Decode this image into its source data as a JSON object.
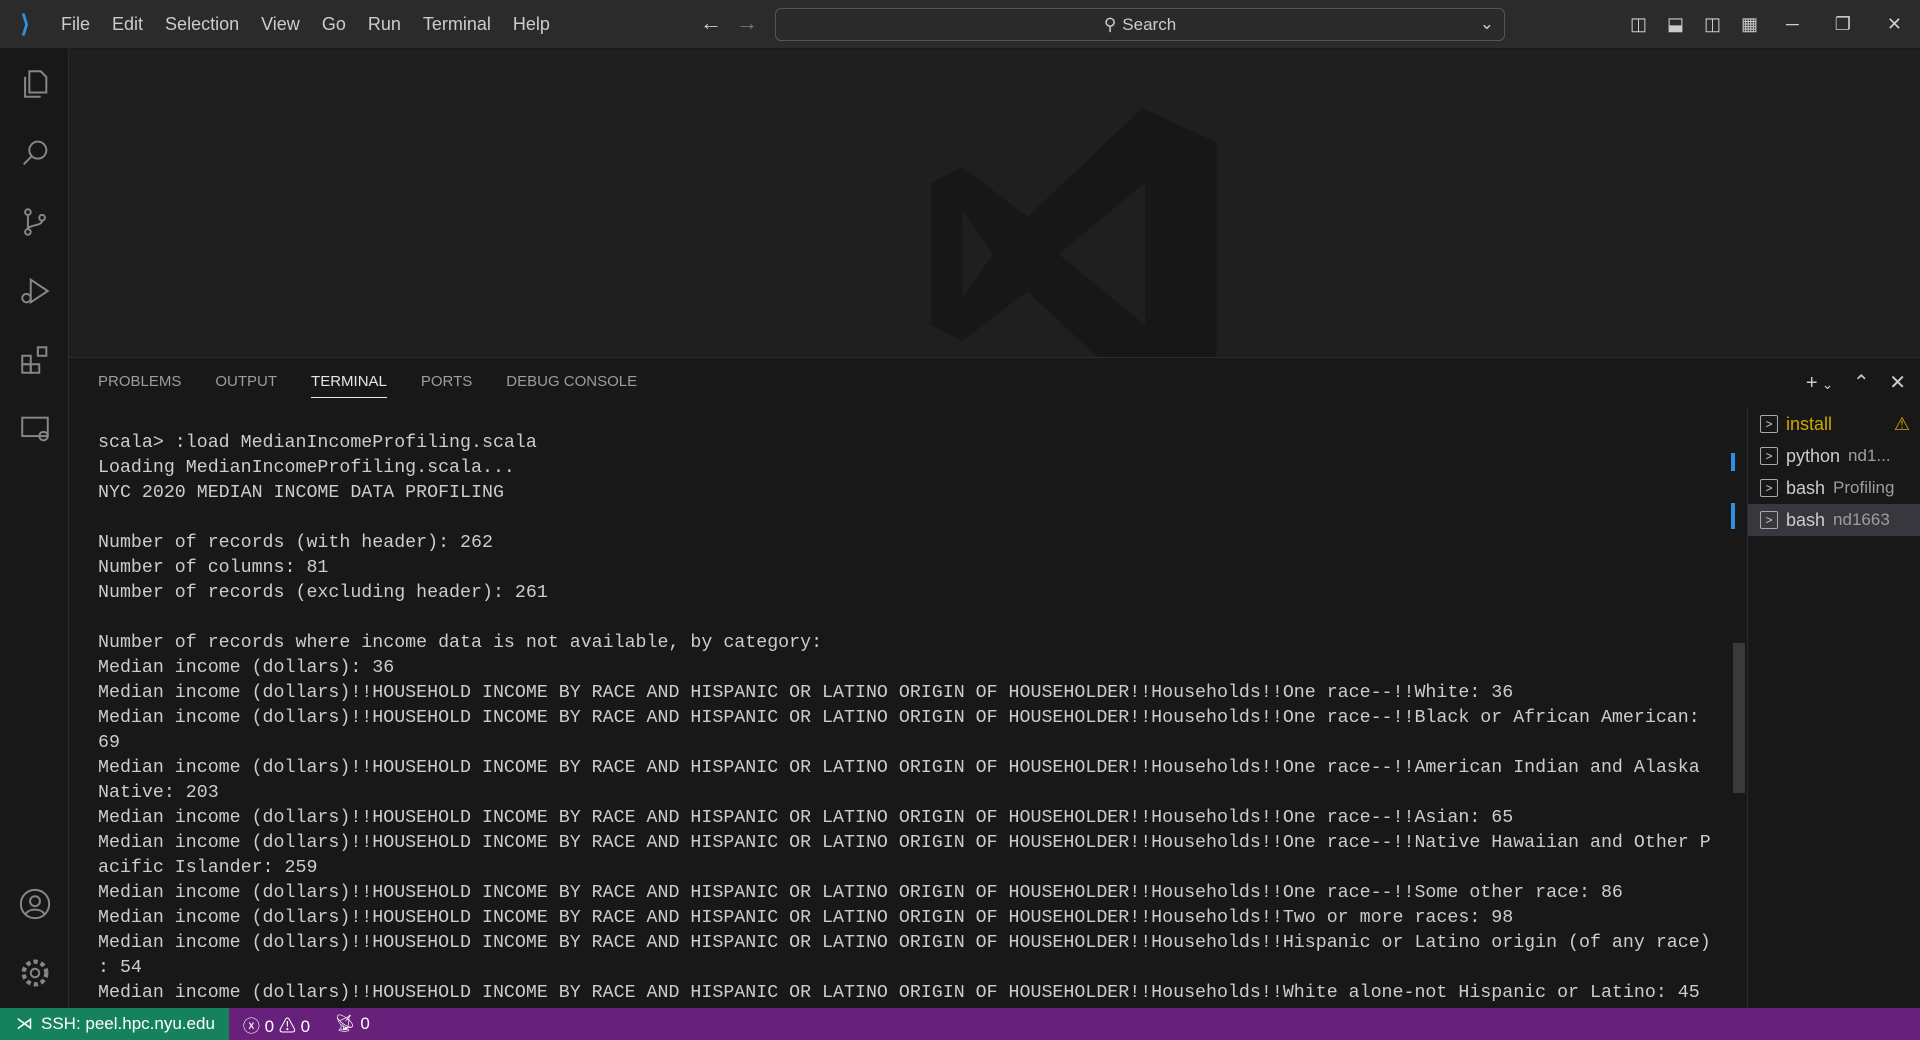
{
  "menu": [
    "File",
    "Edit",
    "Selection",
    "View",
    "Go",
    "Run",
    "Terminal",
    "Help"
  ],
  "search": {
    "label": "Search"
  },
  "panel": {
    "tabs": [
      "PROBLEMS",
      "OUTPUT",
      "TERMINAL",
      "PORTS",
      "DEBUG CONSOLE"
    ],
    "active": "TERMINAL"
  },
  "terminal": {
    "lines": [
      "scala> :load MedianIncomeProfiling.scala",
      "Loading MedianIncomeProfiling.scala...",
      "NYC 2020 MEDIAN INCOME DATA PROFILING",
      "",
      "Number of records (with header): 262",
      "Number of columns: 81",
      "Number of records (excluding header): 261",
      "",
      "Number of records where income data is not available, by category:",
      "Median income (dollars): 36",
      "Median income (dollars)!!HOUSEHOLD INCOME BY RACE AND HISPANIC OR LATINO ORIGIN OF HOUSEHOLDER!!Households!!One race--!!White: 36",
      "Median income (dollars)!!HOUSEHOLD INCOME BY RACE AND HISPANIC OR LATINO ORIGIN OF HOUSEHOLDER!!Households!!One race--!!Black or African American:",
      "69",
      "Median income (dollars)!!HOUSEHOLD INCOME BY RACE AND HISPANIC OR LATINO ORIGIN OF HOUSEHOLDER!!Households!!One race--!!American Indian and Alaska",
      "Native: 203",
      "Median income (dollars)!!HOUSEHOLD INCOME BY RACE AND HISPANIC OR LATINO ORIGIN OF HOUSEHOLDER!!Households!!One race--!!Asian: 65",
      "Median income (dollars)!!HOUSEHOLD INCOME BY RACE AND HISPANIC OR LATINO ORIGIN OF HOUSEHOLDER!!Households!!One race--!!Native Hawaiian and Other P",
      "acific Islander: 259",
      "Median income (dollars)!!HOUSEHOLD INCOME BY RACE AND HISPANIC OR LATINO ORIGIN OF HOUSEHOLDER!!Households!!One race--!!Some other race: 86",
      "Median income (dollars)!!HOUSEHOLD INCOME BY RACE AND HISPANIC OR LATINO ORIGIN OF HOUSEHOLDER!!Households!!Two or more races: 98",
      "Median income (dollars)!!HOUSEHOLD INCOME BY RACE AND HISPANIC OR LATINO ORIGIN OF HOUSEHOLDER!!Households!!Hispanic or Latino origin (of any race)",
      ": 54",
      "Median income (dollars)!!HOUSEHOLD INCOME BY RACE AND HISPANIC OR LATINO ORIGIN OF HOUSEHOLDER!!Households!!White alone-not Hispanic or Latino: 45"
    ]
  },
  "terminal_list": [
    {
      "name": "install",
      "sub": ""
    },
    {
      "name": "python",
      "sub": "nd1..."
    },
    {
      "name": "bash",
      "sub": "Profiling"
    },
    {
      "name": "bash",
      "sub": "nd1663"
    }
  ],
  "status": {
    "remote": "SSH: peel.hpc.nyu.edu",
    "errors": "0",
    "warnings": "0",
    "ports": "0"
  },
  "colors": {
    "accent": "#68217a",
    "remote": "#16825d",
    "warning": "#cca700"
  }
}
